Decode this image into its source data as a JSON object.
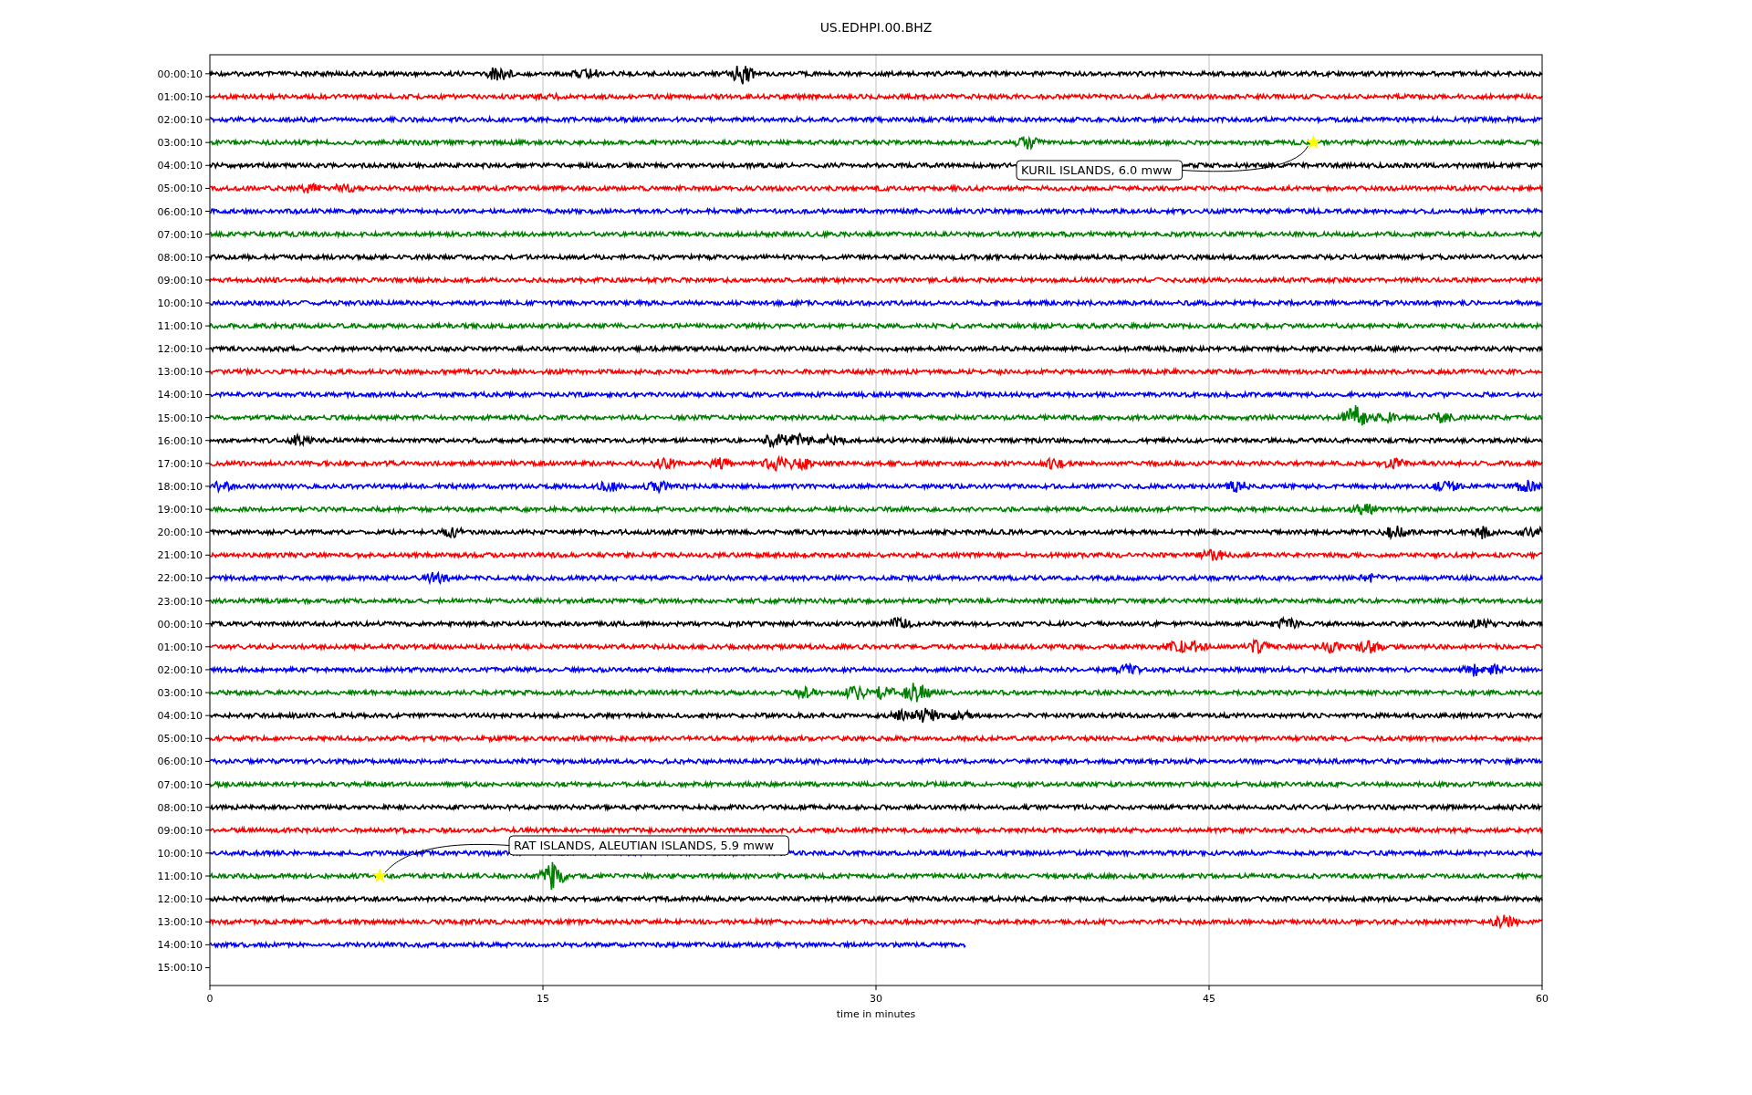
{
  "title": "US.EDHPI.00.BHZ",
  "plot": {
    "rows": [
      {
        "label": "00:00:10",
        "color": "#000000",
        "level": 1
      },
      {
        "label": "01:00:10",
        "color": "#ff0000",
        "level": 1
      },
      {
        "label": "02:00:10",
        "color": "#0000ff",
        "level": 1
      },
      {
        "label": "03:00:10",
        "color": "#008000",
        "level": 1,
        "event": "KURIL ISLANDS, 6.0 mww"
      },
      {
        "label": "04:00:10",
        "color": "#000000",
        "level": 1
      },
      {
        "label": "05:00:10",
        "color": "#ff0000",
        "level": 1
      },
      {
        "label": "06:00:10",
        "color": "#0000ff",
        "level": 1
      },
      {
        "label": "07:00:10",
        "color": "#008000",
        "level": 1
      },
      {
        "label": "08:00:10",
        "color": "#000000",
        "level": 1
      },
      {
        "label": "09:00:10",
        "color": "#ff0000",
        "level": 1
      },
      {
        "label": "10:00:10",
        "color": "#0000ff",
        "level": 1
      },
      {
        "label": "11:00:10",
        "color": "#008000",
        "level": 1
      },
      {
        "label": "12:00:10",
        "color": "#000000",
        "level": 1
      },
      {
        "label": "13:00:10",
        "color": "#ff0000",
        "level": 1
      },
      {
        "label": "14:00:10",
        "color": "#0000ff",
        "level": 1
      },
      {
        "label": "15:00:10",
        "color": "#008000",
        "level": 1
      },
      {
        "label": "16:00:10",
        "color": "#000000",
        "level": 1
      },
      {
        "label": "17:00:10",
        "color": "#ff0000",
        "level": 1
      },
      {
        "label": "18:00:10",
        "color": "#0000ff",
        "level": 1
      },
      {
        "label": "19:00:10",
        "color": "#008000",
        "level": 1
      },
      {
        "label": "20:00:10",
        "color": "#000000",
        "level": 1
      },
      {
        "label": "21:00:10",
        "color": "#ff0000",
        "level": 1
      },
      {
        "label": "22:00:10",
        "color": "#0000ff",
        "level": 1
      },
      {
        "label": "23:00:10",
        "color": "#008000",
        "level": 1
      },
      {
        "label": "00:00:10",
        "color": "#000000",
        "level": 1
      },
      {
        "label": "01:00:10",
        "color": "#ff0000",
        "level": 1
      },
      {
        "label": "02:00:10",
        "color": "#0000ff",
        "level": 1
      },
      {
        "label": "03:00:10",
        "color": "#008000",
        "level": 1
      },
      {
        "label": "04:00:10",
        "color": "#000000",
        "level": 1
      },
      {
        "label": "05:00:10",
        "color": "#ff0000",
        "level": 1
      },
      {
        "label": "06:00:10",
        "color": "#0000ff",
        "level": 1
      },
      {
        "label": "07:00:10",
        "color": "#008000",
        "level": 1
      },
      {
        "label": "08:00:10",
        "color": "#000000",
        "level": 1
      },
      {
        "label": "09:00:10",
        "color": "#ff0000",
        "level": 1
      },
      {
        "label": "10:00:10",
        "color": "#0000ff",
        "level": 1
      },
      {
        "label": "11:00:10",
        "color": "#008000",
        "level": 1,
        "event": "RAT ISLANDS, ALEUTIAN ISLANDS, 5.9 mww"
      },
      {
        "label": "12:00:10",
        "color": "#000000",
        "level": 1
      },
      {
        "label": "13:00:10",
        "color": "#ff0000",
        "level": 1
      },
      {
        "label": "14:00:10",
        "color": "#0000ff",
        "level": 0.567
      },
      {
        "label": "15:00:10"
      }
    ],
    "xticks": [
      "0",
      "15",
      "30",
      "45",
      "60"
    ],
    "xlabel": "time in minutes"
  }
}
